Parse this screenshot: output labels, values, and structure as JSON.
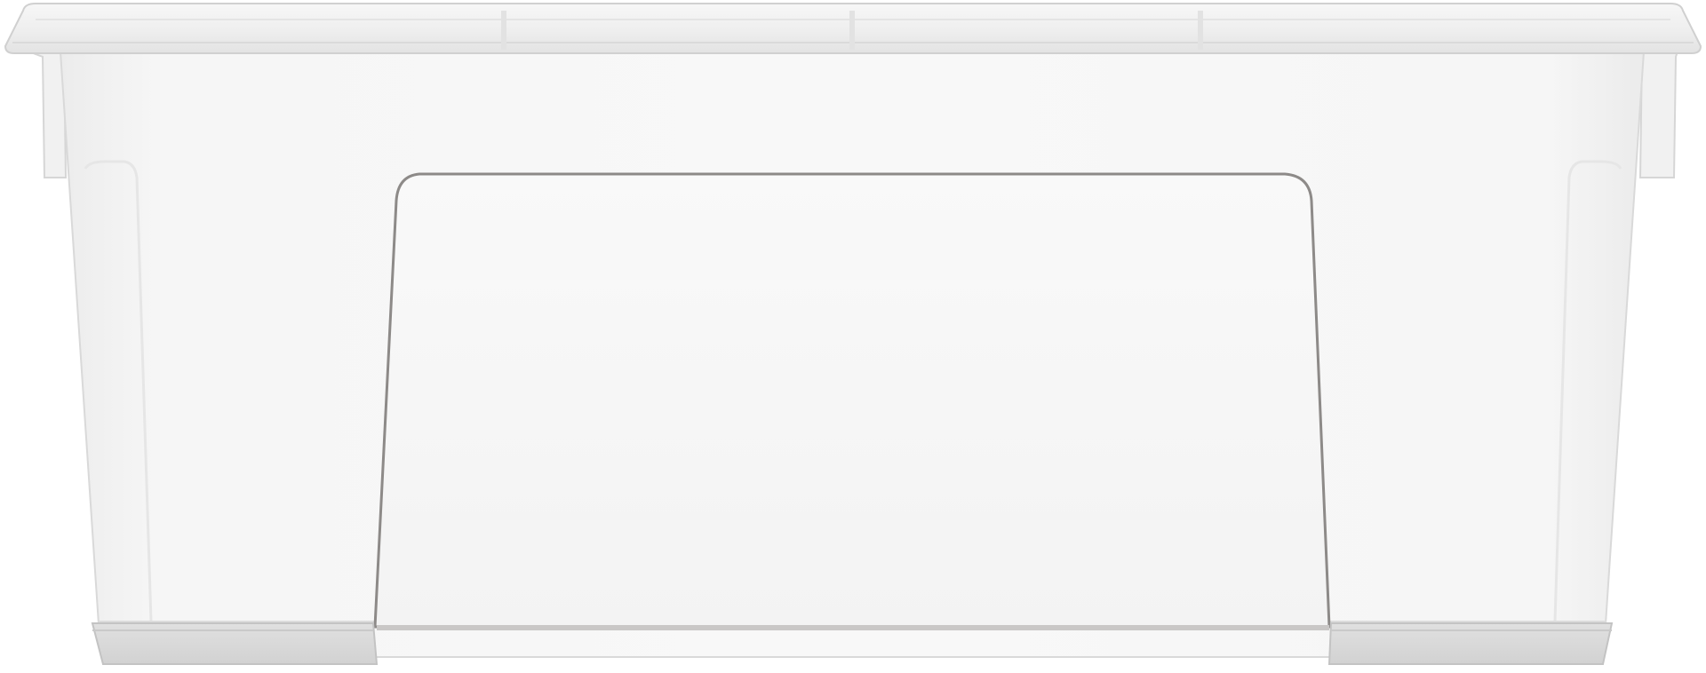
{
  "product": {
    "name": "",
    "colors": {
      "background": "#ffffff",
      "body": "#f4f4f4",
      "lid": "#f2f2f2",
      "edge": "#cfcfcf",
      "window_outline": "#8d8a88",
      "foot_shadow": "#bdbdbd"
    }
  }
}
